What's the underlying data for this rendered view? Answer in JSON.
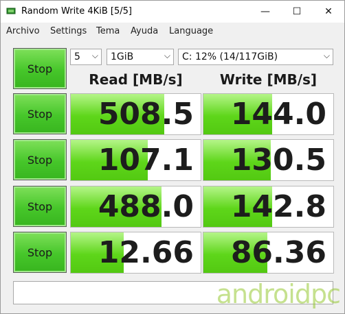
{
  "window": {
    "title": "Random Write 4KiB [5/5]",
    "minimize_glyph": "—",
    "maximize_glyph": "☐",
    "close_glyph": "✕"
  },
  "menu": [
    "Archivo",
    "Settings",
    "Tema",
    "Ayuda",
    "Language"
  ],
  "controls": {
    "count": "5",
    "size": "1GiB",
    "drive": "C: 12% (14/117GiB)"
  },
  "headers": {
    "read": "Read [MB/s]",
    "write": "Write [MB/s]"
  },
  "all_button": "Stop",
  "rows": [
    {
      "button": "Stop",
      "read": "508.5",
      "write": "144.0",
      "read_fill": 0.72,
      "write_fill": 0.53
    },
    {
      "button": "Stop",
      "read": "107.1",
      "write": "130.5",
      "read_fill": 0.59,
      "write_fill": 0.52
    },
    {
      "button": "Stop",
      "read": "488.0",
      "write": "142.8",
      "read_fill": 0.7,
      "write_fill": 0.53
    },
    {
      "button": "Stop",
      "read": "12.66",
      "write": "86.36",
      "read_fill": 0.41,
      "write_fill": 0.49
    }
  ],
  "status": "",
  "watermark": "androidpc",
  "colors": {
    "accent_green": "#46c62a",
    "fill_green": "#5ed61a"
  },
  "icons": {
    "app": "disk-benchmark-icon"
  }
}
